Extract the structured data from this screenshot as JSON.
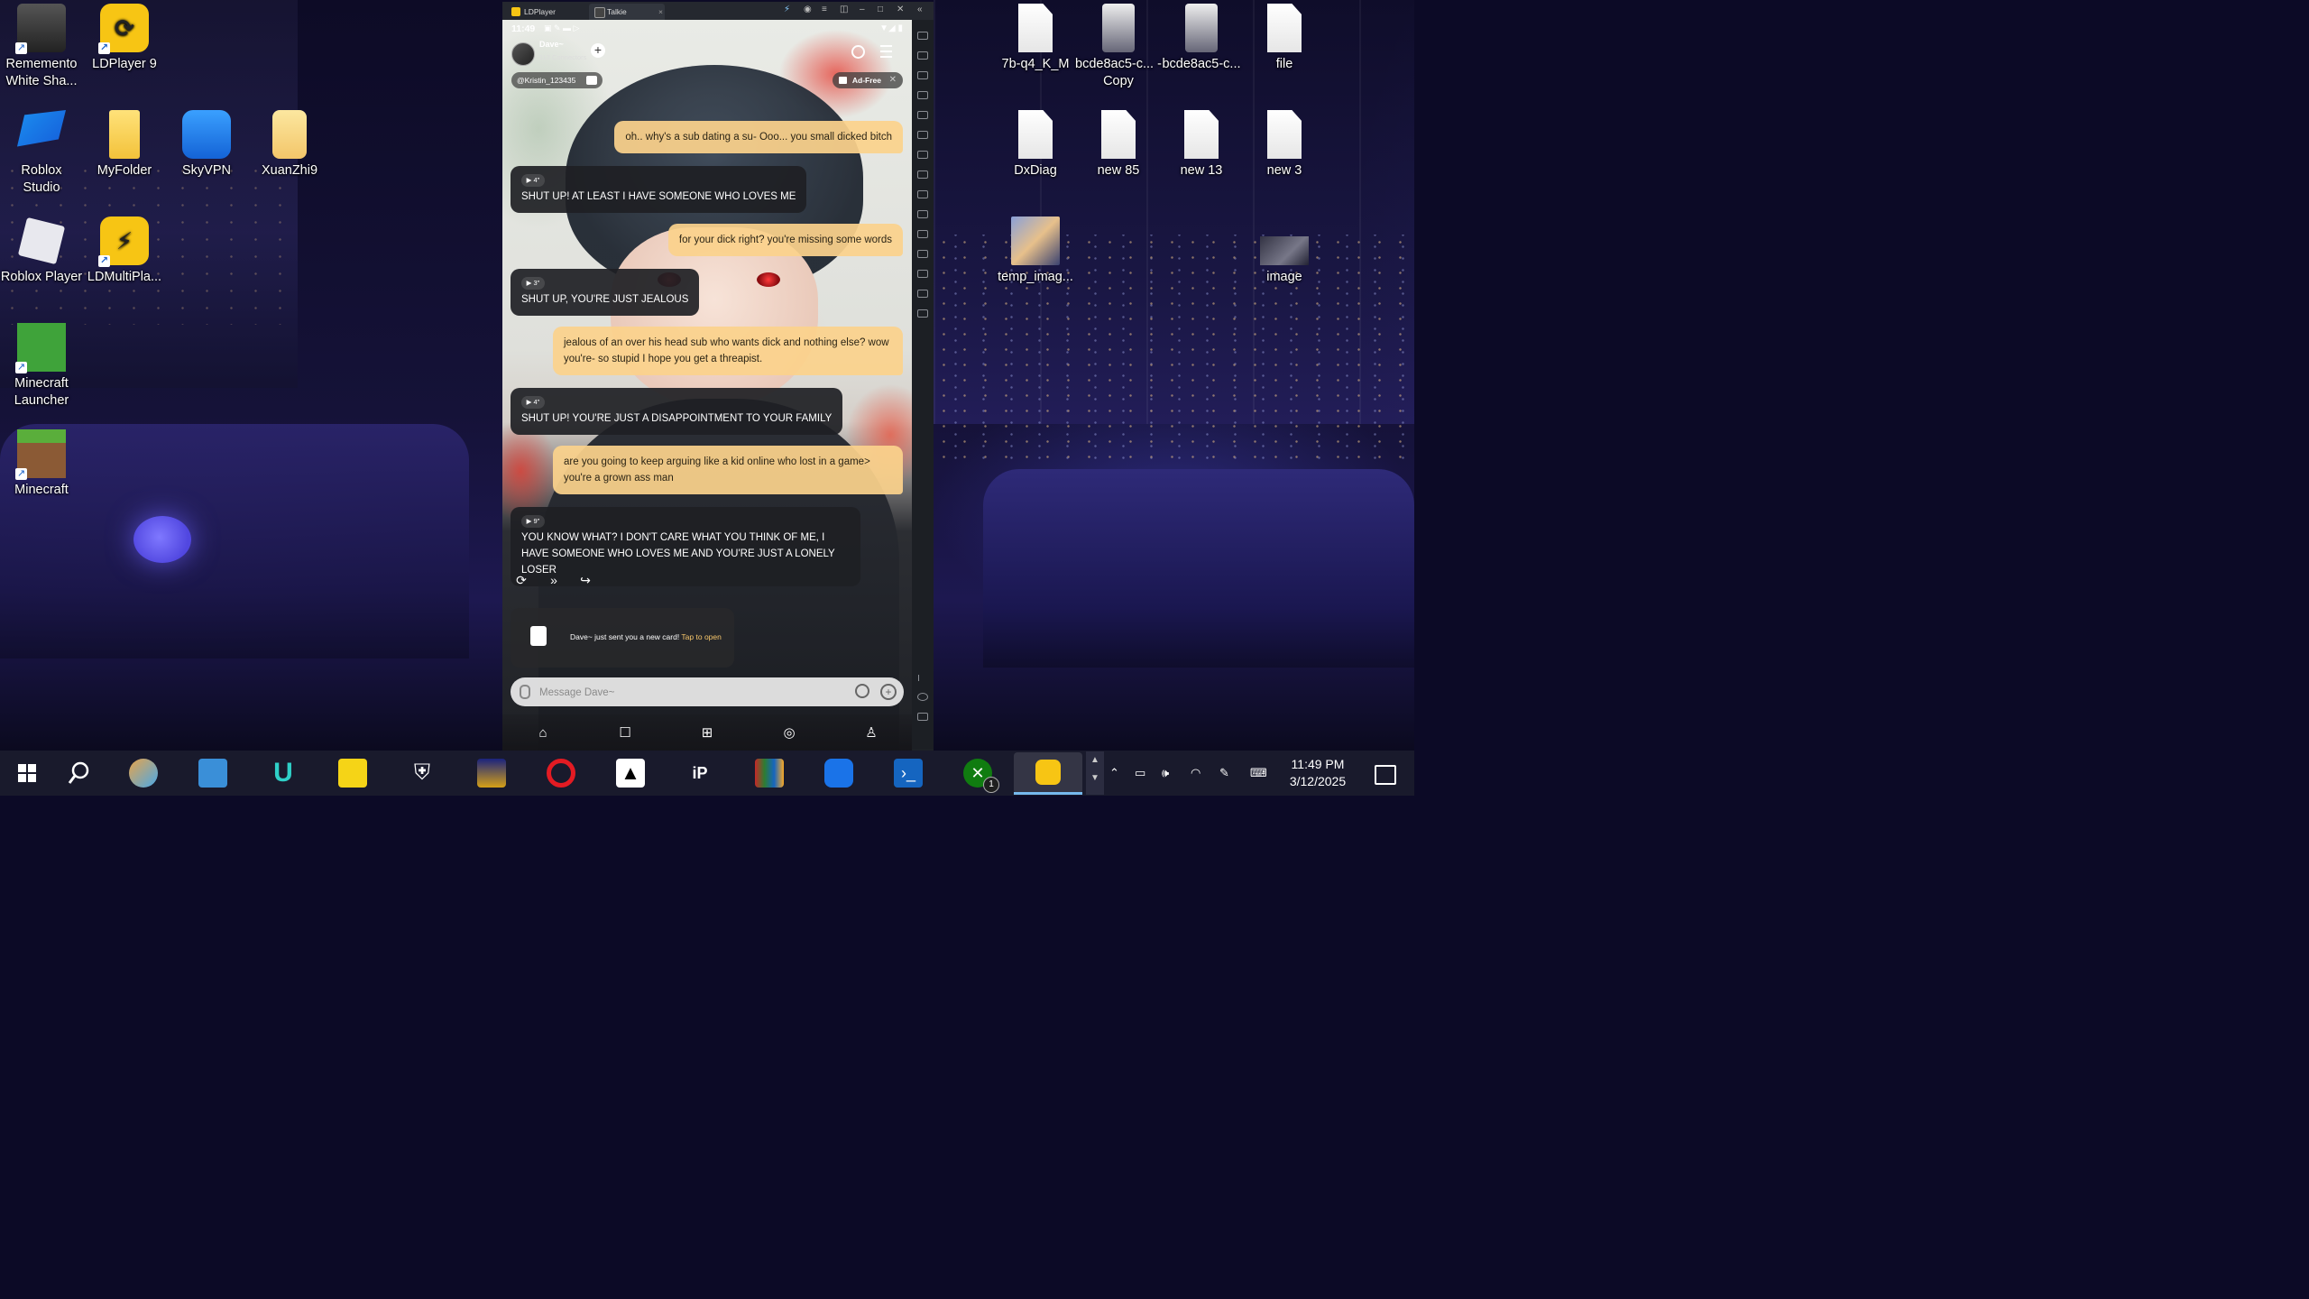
{
  "desktop_left": [
    {
      "label": "Rememento White Sha..."
    },
    {
      "label": "LDPlayer 9"
    },
    {
      "label": "Roblox Studio"
    },
    {
      "label": "MyFolder"
    },
    {
      "label": "SkyVPN"
    },
    {
      "label": "XuanZhi9"
    },
    {
      "label": "Roblox Player"
    },
    {
      "label": "LDMultiPla..."
    },
    {
      "label": "Minecraft Launcher"
    },
    {
      "label": "Minecraft"
    }
  ],
  "desktop_right": [
    {
      "label": "7b-q4_K_M"
    },
    {
      "label": "bcde8ac5-c... - Copy"
    },
    {
      "label": "bcde8ac5-c..."
    },
    {
      "label": "file"
    },
    {
      "label": "DxDiag"
    },
    {
      "label": "new 85"
    },
    {
      "label": "new 13"
    },
    {
      "label": "new 3"
    },
    {
      "label": "temp_imag..."
    },
    {
      "label": "image"
    }
  ],
  "ldplayer": {
    "tabs": [
      {
        "label": "LDPlayer"
      },
      {
        "label": "Talkie"
      }
    ],
    "tab_close": "×"
  },
  "phone": {
    "time": "11:49",
    "character_name": "Dave~",
    "connectors": "112 Connectors",
    "user_handle": "@Kristin_123435",
    "adfree_label": "Ad-Free",
    "messages": [
      {
        "role": "user",
        "text": "oh.. why's a sub dating a su- Ooo... you small dicked bitch"
      },
      {
        "role": "bot",
        "audio": "4\"",
        "text": "SHUT UP! AT LEAST I HAVE SOMEONE WHO LOVES ME"
      },
      {
        "role": "user",
        "text": "for your dick right? you're missing some words"
      },
      {
        "role": "bot",
        "audio": "3\"",
        "text": "SHUT UP, YOU'RE JUST JEALOUS"
      },
      {
        "role": "user",
        "text": "jealous of an over his head sub who wants dick and nothing else? wow you're- so stupid I hope you get a threapist."
      },
      {
        "role": "bot",
        "audio": "4\"",
        "text": "SHUT UP! YOU'RE JUST A DISAPPOINTMENT TO YOUR FAMILY"
      },
      {
        "role": "user",
        "text": "are you going to keep arguing like a kid online who lost in a game> you're a grown ass man"
      },
      {
        "role": "bot",
        "audio": "9\"",
        "text": "YOU KNOW WHAT? I DON'T CARE WHAT YOU THINK OF ME, I HAVE SOMEONE WHO LOVES ME AND YOU'RE JUST A LONELY LOSER"
      }
    ],
    "card_note": "Dave~ just sent you a new card!",
    "card_note_action": "Tap to open",
    "input_placeholder": "Message Dave~"
  },
  "taskbar": {
    "time": "11:49 PM",
    "date": "3/12/2025",
    "badge": "1"
  },
  "colors": {
    "user_bubble": "#fbd28c",
    "bot_bubble": "#1e2024",
    "ld_accent": "#f7c514",
    "taskbar": "#191a2c"
  }
}
